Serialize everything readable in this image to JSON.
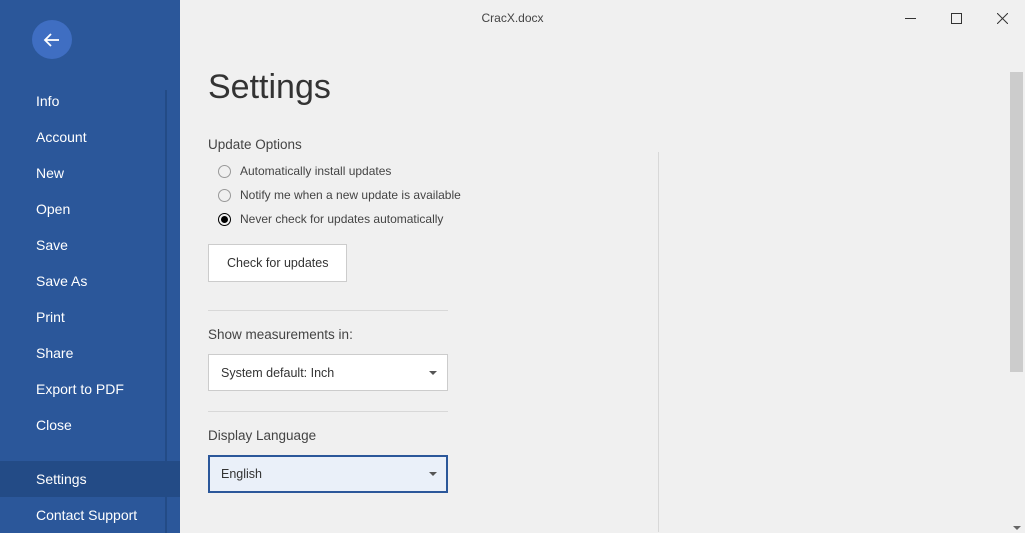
{
  "window": {
    "title": "CracX.docx"
  },
  "sidebar": {
    "items": [
      {
        "label": "Info",
        "selected": false
      },
      {
        "label": "Account",
        "selected": false
      },
      {
        "label": "New",
        "selected": false
      },
      {
        "label": "Open",
        "selected": false
      },
      {
        "label": "Save",
        "selected": false
      },
      {
        "label": "Save As",
        "selected": false
      },
      {
        "label": "Print",
        "selected": false
      },
      {
        "label": "Share",
        "selected": false
      },
      {
        "label": "Export to PDF",
        "selected": false
      },
      {
        "label": "Close",
        "selected": false
      },
      {
        "label": "Settings",
        "selected": true
      },
      {
        "label": "Contact Support",
        "selected": false
      }
    ]
  },
  "page": {
    "title": "Settings",
    "update_options": {
      "heading": "Update Options",
      "options": [
        {
          "label": "Automatically install updates",
          "checked": false
        },
        {
          "label": "Notify me when a new update is available",
          "checked": false
        },
        {
          "label": "Never check for updates automatically",
          "checked": true
        }
      ],
      "check_button": "Check for updates"
    },
    "measurements": {
      "heading": "Show measurements in:",
      "value": "System default: Inch"
    },
    "language": {
      "heading": "Display Language",
      "value": "English"
    }
  }
}
